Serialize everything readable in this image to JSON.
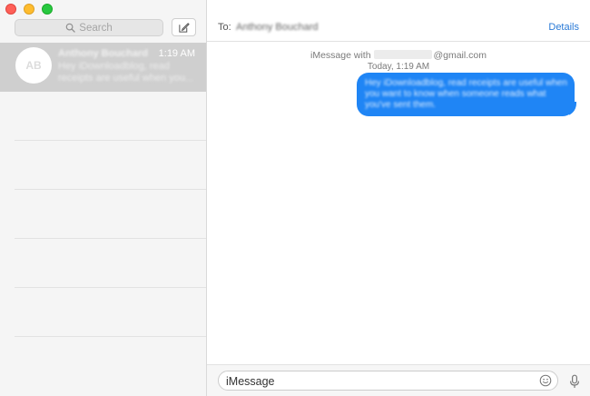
{
  "sidebar": {
    "search_placeholder": "Search",
    "conversation": {
      "initials": "AB",
      "name": "Anthony Bouchard",
      "time": "1:19 AM",
      "preview": "Hey iDownloadblog, read receipts are useful when you..."
    }
  },
  "header": {
    "to_label": "To:",
    "recipient": "Anthony Bouchard",
    "details": "Details"
  },
  "thread": {
    "imessage_prefix": "iMessage with",
    "email_suffix": "@gmail.com",
    "timestamp": "Today, 1:19 AM",
    "message": "Hey iDownloadblog, read receipts are useful when you want to know when someone reads what you've sent them."
  },
  "composer": {
    "placeholder": "iMessage"
  },
  "colors": {
    "accent_blue": "#1f85f5",
    "link_blue": "#2a7ad6",
    "traffic_red": "#fe5f57",
    "traffic_yellow": "#febc2e",
    "traffic_green": "#28c840"
  }
}
